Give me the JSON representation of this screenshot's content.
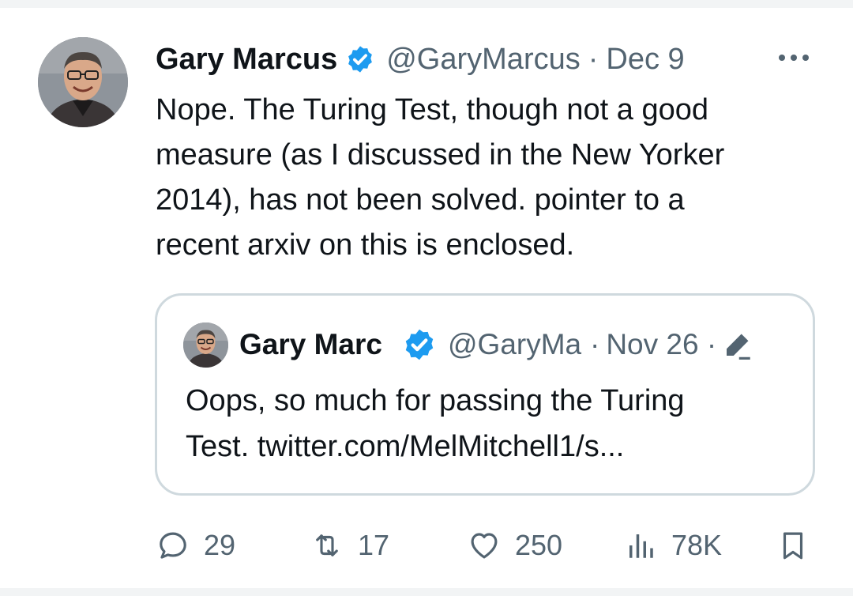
{
  "author": {
    "name": "Gary Marcus",
    "handle": "@GaryMarcus",
    "separator": "·",
    "date": "Dec 9"
  },
  "tweet": {
    "text": "Nope. The Turing Test, though not a good\nmeasure (as I discussed in the New Yorker\n2014), has not been solved.  pointer to a\nrecent arxiv on this is enclosed."
  },
  "quoted": {
    "name": "Gary Marc",
    "handle": "@GaryMa",
    "separator": "·",
    "date": "Nov 26 ·",
    "text": "Oops, so much for passing the Turing\nTest. twitter.com/MelMitchell1/s..."
  },
  "actions": {
    "replies": "29",
    "retweets": "17",
    "likes": "250",
    "views": "78K"
  },
  "icons": [
    "verified-badge-icon",
    "more-icon",
    "edit-icon",
    "reply-icon",
    "retweet-icon",
    "like-icon",
    "views-icon",
    "bookmark-icon"
  ],
  "colors": {
    "verified": "#1d9bf0",
    "text": "#0f1419",
    "muted": "#536471",
    "border": "#cfd9de"
  }
}
